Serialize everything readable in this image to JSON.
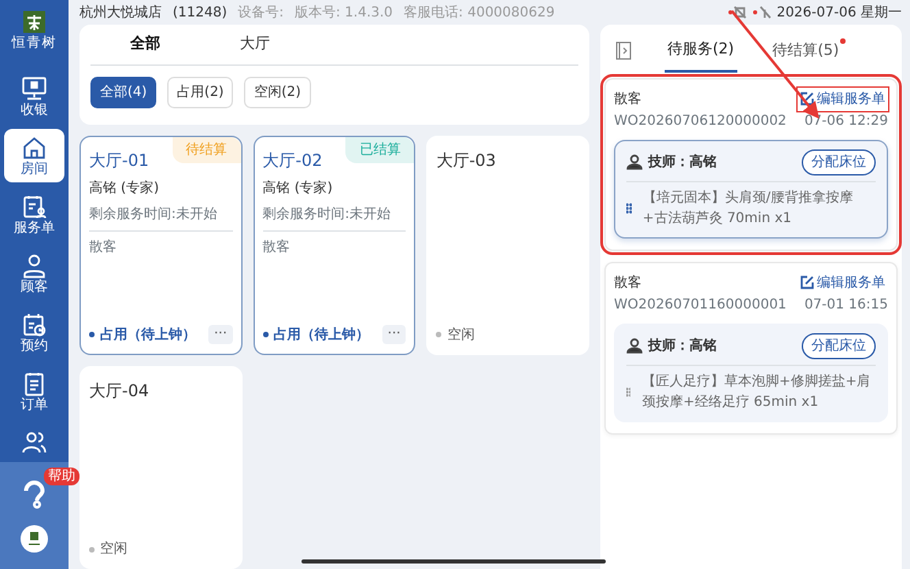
{
  "status_bar": {
    "store": "杭州大悦城店",
    "store_code": "(11248)",
    "device_label": "设备号:",
    "version": "版本号: 1.4.3.0",
    "hotline": "客服电话: 4000080629",
    "date": "2026-07-06 星期一"
  },
  "sidebar": {
    "logo_text": "恒青树",
    "items": [
      {
        "kind": "cashier",
        "label": "收银",
        "selected": false
      },
      {
        "kind": "room",
        "label": "房间",
        "selected": true
      },
      {
        "kind": "service",
        "label": "服务单",
        "selected": false
      },
      {
        "kind": "customer",
        "label": "顾客",
        "selected": false
      },
      {
        "kind": "booking",
        "label": "预约",
        "selected": false
      },
      {
        "kind": "order",
        "label": "订单",
        "selected": false
      },
      {
        "kind": "staff",
        "selected": false
      }
    ],
    "help_badge": "帮助"
  },
  "area_tabs": [
    {
      "label": "全部",
      "selected": true
    },
    {
      "label": "大厅",
      "selected": false
    }
  ],
  "filters": [
    {
      "label": "全部(4)",
      "selected": true
    },
    {
      "label": "占用(2)",
      "selected": false
    },
    {
      "label": "空闲(2)",
      "selected": false
    }
  ],
  "rooms": [
    {
      "kind": "occupied",
      "name": "大厅-01",
      "badge": {
        "text": "待结算",
        "color": "#f0a020"
      },
      "technician": "高铭 (专家)",
      "remaining": "剩余服务时间:未开始",
      "customer": "散客",
      "status": "占用（待上钟）",
      "more": "···"
    },
    {
      "kind": "occupied",
      "name": "大厅-02",
      "badge": {
        "text": "已结算",
        "color": "#1cae9c"
      },
      "technician": "高铭 (专家)",
      "remaining": "剩余服务时间:未开始",
      "customer": "散客",
      "status": "占用（待上钟）",
      "more": "···"
    },
    {
      "kind": "free",
      "name": "大厅-03",
      "status": "空闲"
    },
    {
      "kind": "free",
      "name": "大厅-04",
      "status": "空闲"
    }
  ],
  "order_tabs": [
    {
      "label": "待服务(2)",
      "selected": true,
      "dot": false
    },
    {
      "label": "待结算(5)",
      "selected": false,
      "dot": true
    }
  ],
  "orders": [
    {
      "customer": "散客",
      "edit": "编辑服务单",
      "order_no": "WO20260706120000002",
      "time": "07-06 12:29",
      "technician": "技师：高铭",
      "assign": "分配床位",
      "service": "【培元固本】头肩颈/腰背推拿按摩+古法葫芦灸 70min x1",
      "selected": true,
      "highlighted": true
    },
    {
      "customer": "散客",
      "edit": "编辑服务单",
      "order_no": "WO20260701160000001",
      "time": "07-01 16:15",
      "technician": "技师：高铭",
      "assign": "分配床位",
      "service": "【匠人足疗】草本泡脚+修脚搓盐+肩颈按摩+经络足疗 65min x1",
      "selected": false,
      "highlighted": false
    }
  ]
}
